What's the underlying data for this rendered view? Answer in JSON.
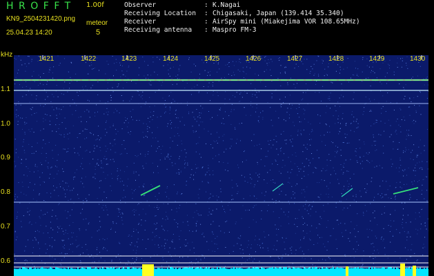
{
  "header": {
    "app_title": "HROFFT",
    "version": "1.00f",
    "filename": "KN9_2504231420.png",
    "tag": "meteor",
    "datetime": "25.04.23 14:20",
    "count": "5"
  },
  "info": [
    {
      "label": "Observer",
      "value": "K.Nagai"
    },
    {
      "label": "Receiving Location",
      "value": "Chigasaki, Japan (139.414 35.340)"
    },
    {
      "label": "Receiver",
      "value": "AirSpy mini (Miakejima VOR 108.65MHz)"
    },
    {
      "label": "Receiving antenna",
      "value": "Maspro FM-3"
    }
  ],
  "axis": {
    "y_unit": "kHz",
    "y_ticks": [
      "1.1",
      "1.0",
      "0.9",
      "0.8",
      "0.7",
      "0.6"
    ],
    "x_ticks": [
      "1421",
      "1422",
      "1423",
      "1424",
      "1425",
      "1426",
      "1427",
      "1428",
      "1429",
      "1430"
    ]
  },
  "colors": {
    "background": "#000000",
    "plot_background": "#0b1a6a",
    "title_green": "#39e34a",
    "label_yellow": "#e8e020",
    "baseline_cyan": "#00e6ff",
    "echo_yellow": "#ffff20"
  }
}
